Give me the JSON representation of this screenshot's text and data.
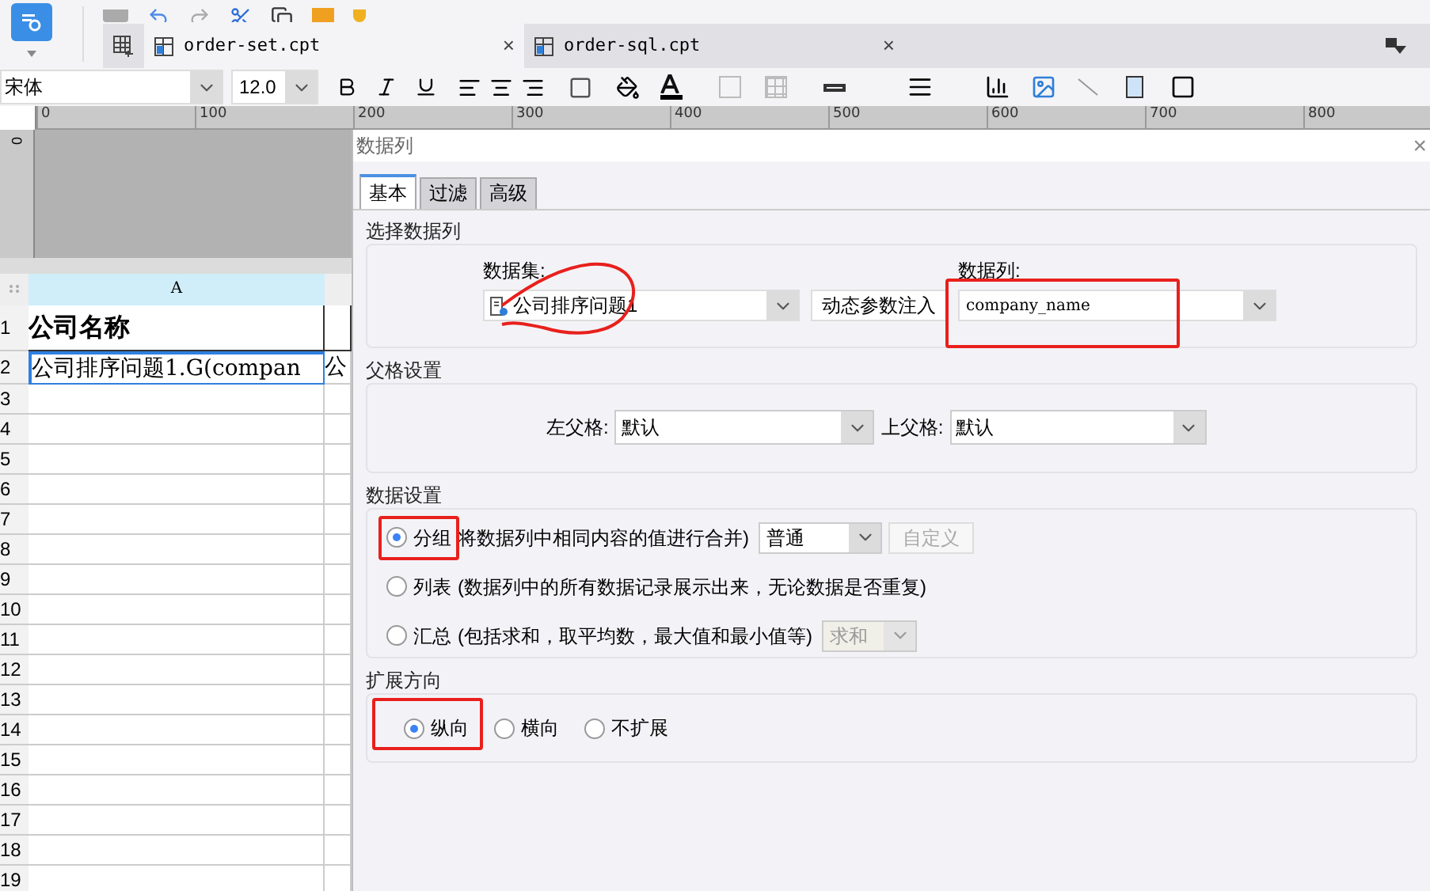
{
  "tabs": [
    {
      "label": "order-set.cpt",
      "selected": true,
      "close": "×"
    },
    {
      "label": "order-sql.cpt",
      "selected": false,
      "close": "×"
    }
  ],
  "format_bar": {
    "font": "宋体",
    "size": "12.0"
  },
  "ruler": {
    "ticks": [
      "0",
      "100",
      "200",
      "300",
      "400",
      "500",
      "600",
      "700",
      "800"
    ],
    "side_tick": "0"
  },
  "sheet": {
    "columns": [
      "A"
    ],
    "rows": [
      {
        "number": "1",
        "cells": [
          "公司名称",
          ""
        ],
        "header": true,
        "selected": false
      },
      {
        "number": "2",
        "cells": [
          "公司排序问题1.G(compan",
          "公"
        ],
        "header": false,
        "selected": true
      },
      {
        "number": "3",
        "cells": [
          "",
          ""
        ],
        "header": false,
        "selected": false
      },
      {
        "number": "4",
        "cells": [
          "",
          ""
        ],
        "header": false,
        "selected": false
      },
      {
        "number": "5",
        "cells": [
          "",
          ""
        ],
        "header": false,
        "selected": false
      },
      {
        "number": "6",
        "cells": [
          "",
          ""
        ],
        "header": false,
        "selected": false
      },
      {
        "number": "7",
        "cells": [
          "",
          ""
        ],
        "header": false,
        "selected": false
      },
      {
        "number": "8",
        "cells": [
          "",
          ""
        ],
        "header": false,
        "selected": false
      },
      {
        "number": "9",
        "cells": [
          "",
          ""
        ],
        "header": false,
        "selected": false
      },
      {
        "number": "10",
        "cells": [
          "",
          ""
        ],
        "header": false,
        "selected": false
      },
      {
        "number": "11",
        "cells": [
          "",
          ""
        ],
        "header": false,
        "selected": false
      },
      {
        "number": "12",
        "cells": [
          "",
          ""
        ],
        "header": false,
        "selected": false
      },
      {
        "number": "13",
        "cells": [
          "",
          ""
        ],
        "header": false,
        "selected": false
      },
      {
        "number": "14",
        "cells": [
          "",
          ""
        ],
        "header": false,
        "selected": false
      },
      {
        "number": "15",
        "cells": [
          "",
          ""
        ],
        "header": false,
        "selected": false
      },
      {
        "number": "16",
        "cells": [
          "",
          ""
        ],
        "header": false,
        "selected": false
      },
      {
        "number": "17",
        "cells": [
          "",
          ""
        ],
        "header": false,
        "selected": false
      },
      {
        "number": "18",
        "cells": [
          "",
          ""
        ],
        "header": false,
        "selected": false
      },
      {
        "number": "19",
        "cells": [
          "",
          ""
        ],
        "header": false,
        "selected": false
      }
    ]
  },
  "dialog": {
    "title": "数据列",
    "close": "×",
    "tabs": [
      {
        "label": "基本",
        "selected": true
      },
      {
        "label": "过滤",
        "selected": false
      },
      {
        "label": "高级",
        "selected": false
      }
    ],
    "select_column": {
      "title": "选择数据列",
      "dataset_label": "数据集:",
      "dataset": "公司排序问题1",
      "dataset_circled": true,
      "inject_button": "动态参数注入",
      "column_label": "数据列:",
      "column": "company_name",
      "column_highlighted": true
    },
    "parent": {
      "title": "父格设置",
      "left_label": "左父格:",
      "left": "默认",
      "top_label": "上父格:",
      "top": "默认"
    },
    "data_settings": {
      "title": "数据设置",
      "options": [
        {
          "label": "分组",
          "note": "将数据列中相同内容的值进行合并)",
          "selected": true,
          "highlighted": true,
          "select": {
            "value": "普通",
            "disabled": false
          },
          "button": {
            "label": "自定义",
            "disabled": true
          }
        },
        {
          "label": "列表",
          "note": "(数据列中的所有数据记录展示出来，无论数据是否重复)",
          "selected": false,
          "highlighted": false
        },
        {
          "label": "汇总",
          "note": "(包括求和，取平均数，最大值和最小值等)",
          "selected": false,
          "highlighted": false,
          "select": {
            "value": "求和",
            "disabled": true
          }
        }
      ]
    },
    "expand": {
      "title": "扩展方向",
      "options": [
        {
          "label": "纵向",
          "selected": true,
          "highlighted": true
        },
        {
          "label": "横向",
          "selected": false,
          "highlighted": false
        },
        {
          "label": "不扩展",
          "selected": false,
          "highlighted": false
        }
      ]
    }
  }
}
